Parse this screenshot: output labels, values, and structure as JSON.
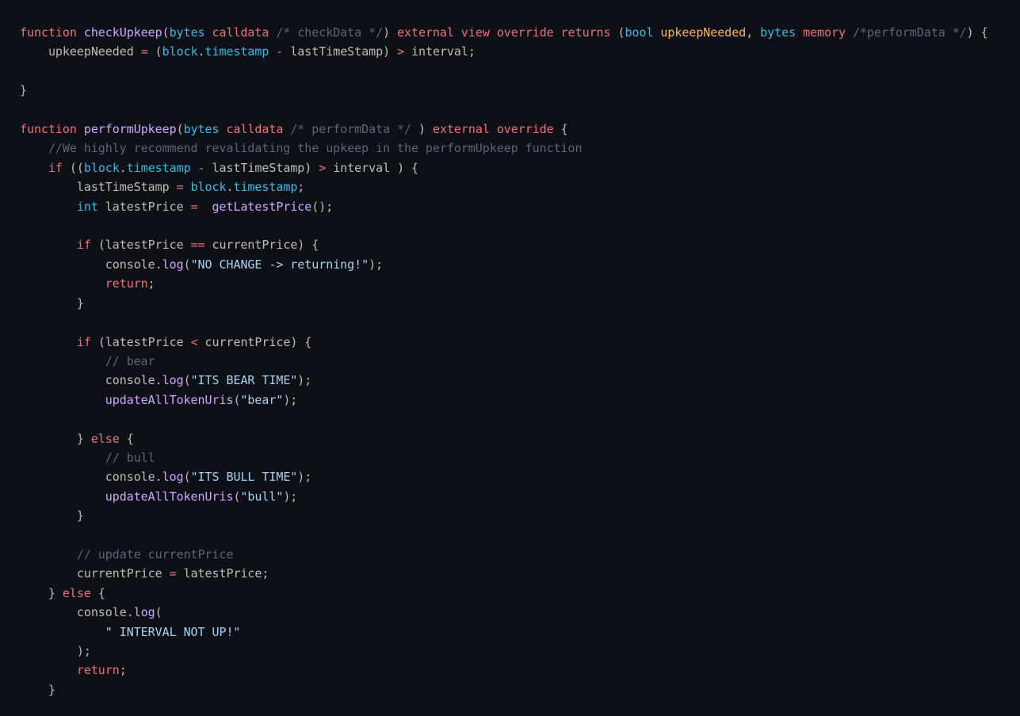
{
  "editor": {
    "language": "solidity",
    "theme": "ayu-dark",
    "background_color": "#0d1017",
    "foreground_color": "#bfbdb6",
    "font_size_px": 15,
    "line_height_px": 24.4,
    "indent_size": 4
  },
  "palette": {
    "keyword": "#f07178",
    "function_name": "#d2a6ff",
    "type": "#39bae6",
    "variable": "#ffb454",
    "identifier": "#bfbdb6",
    "string": "#a6d2f0",
    "comment": "#5c6773",
    "operator": "#f07178",
    "punctuation": "#bfbdb6"
  },
  "code": {
    "lines": [
      "function checkUpkeep(bytes calldata /* checkData */) external view override returns (bool upkeepNeeded, bytes memory /*performData */) {",
      "    upkeepNeeded = (block.timestamp - lastTimeStamp) > interval;",
      "",
      "}",
      "",
      "function performUpkeep(bytes calldata /* performData */ ) external override {",
      "    //We highly recommend revalidating the upkeep in the performUpkeep function",
      "    if ((block.timestamp - lastTimeStamp) > interval ) {",
      "        lastTimeStamp = block.timestamp;",
      "        int latestPrice =  getLatestPrice();",
      "",
      "        if (latestPrice == currentPrice) {",
      "            console.log(\"NO CHANGE -> returning!\");",
      "            return;",
      "        }",
      "",
      "        if (latestPrice < currentPrice) {",
      "            // bear",
      "            console.log(\"ITS BEAR TIME\");",
      "            updateAllTokenUris(\"bear\");",
      "",
      "        } else {",
      "            // bull",
      "            console.log(\"ITS BULL TIME\");",
      "            updateAllTokenUris(\"bull\");",
      "        }",
      "",
      "        // update currentPrice",
      "        currentPrice = latestPrice;",
      "    } else {",
      "        console.log(",
      "            \" INTERVAL NOT UP!\"",
      "        );",
      "        return;",
      "    }"
    ],
    "tokens": {
      "keywords": [
        "function",
        "external",
        "view",
        "override",
        "returns",
        "memory",
        "calldata",
        "if",
        "else",
        "return"
      ],
      "types": [
        "bytes",
        "bool",
        "int",
        "block"
      ],
      "function_names": [
        "checkUpkeep",
        "performUpkeep",
        "getLatestPrice",
        "log",
        "updateAllTokenUris"
      ],
      "variables": [
        "upkeepNeeded",
        "lastTimeStamp",
        "interval",
        "latestPrice",
        "currentPrice",
        "console",
        "timestamp"
      ],
      "strings": [
        "\"NO CHANGE -> returning!\"",
        "\"ITS BEAR TIME\"",
        "\"bear\"",
        "\"ITS BULL TIME\"",
        "\"bull\"",
        "\" INTERVAL NOT UP!\""
      ],
      "comments": [
        "/* checkData */",
        "/*performData */",
        "/* performData */",
        "//We highly recommend revalidating the upkeep in the performUpkeep function",
        "// bear",
        "// bull",
        "// update currentPrice"
      ]
    }
  }
}
